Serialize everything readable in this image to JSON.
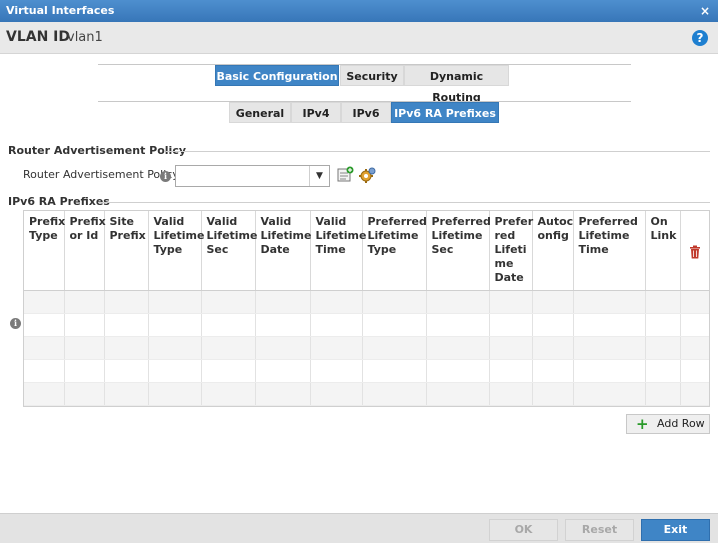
{
  "window": {
    "title": "Virtual Interfaces",
    "close_glyph": "×"
  },
  "vlan": {
    "label": "VLAN ID",
    "value": "vlan1",
    "help_glyph": "?"
  },
  "tabs_primary": [
    {
      "label": "Basic Configuration",
      "active": true
    },
    {
      "label": "Security",
      "active": false
    },
    {
      "label": "Dynamic Routing",
      "active": false
    }
  ],
  "tabs_secondary": [
    {
      "label": "General",
      "active": false
    },
    {
      "label": "IPv4",
      "active": false
    },
    {
      "label": "IPv6",
      "active": false
    },
    {
      "label": "IPv6 RA Prefixes",
      "active": true
    }
  ],
  "router_policy": {
    "section_title": "Router Advertisement Policy",
    "field_label": "Router Advertisement Policy",
    "value": "",
    "icons": [
      "create-policy-icon",
      "edit-policy-icon"
    ]
  },
  "prefixes": {
    "section_title": "IPv6 RA Prefixes",
    "columns": [
      "Prefix Type",
      "Prefix or Id",
      "Site Prefix",
      "Valid Lifetime Type",
      "Valid Lifetime Sec",
      "Valid Lifetime Date",
      "Valid Lifetime Time",
      "Preferred Lifetime Type",
      "Preferred Lifetime Sec",
      "Prefer red Lifeti me Date",
      "Autoc onfig",
      "Preferred Lifetime Time",
      "On Link"
    ],
    "rows": [],
    "empty_row_count": 5,
    "add_row_label": "Add Row"
  },
  "footer": {
    "ok": "OK",
    "reset": "Reset",
    "exit": "Exit"
  },
  "colors": {
    "accent": "#3f85c6",
    "titlebar": "#3776b8",
    "add_plus": "#2a9a2a",
    "trash": "#c0392b"
  }
}
